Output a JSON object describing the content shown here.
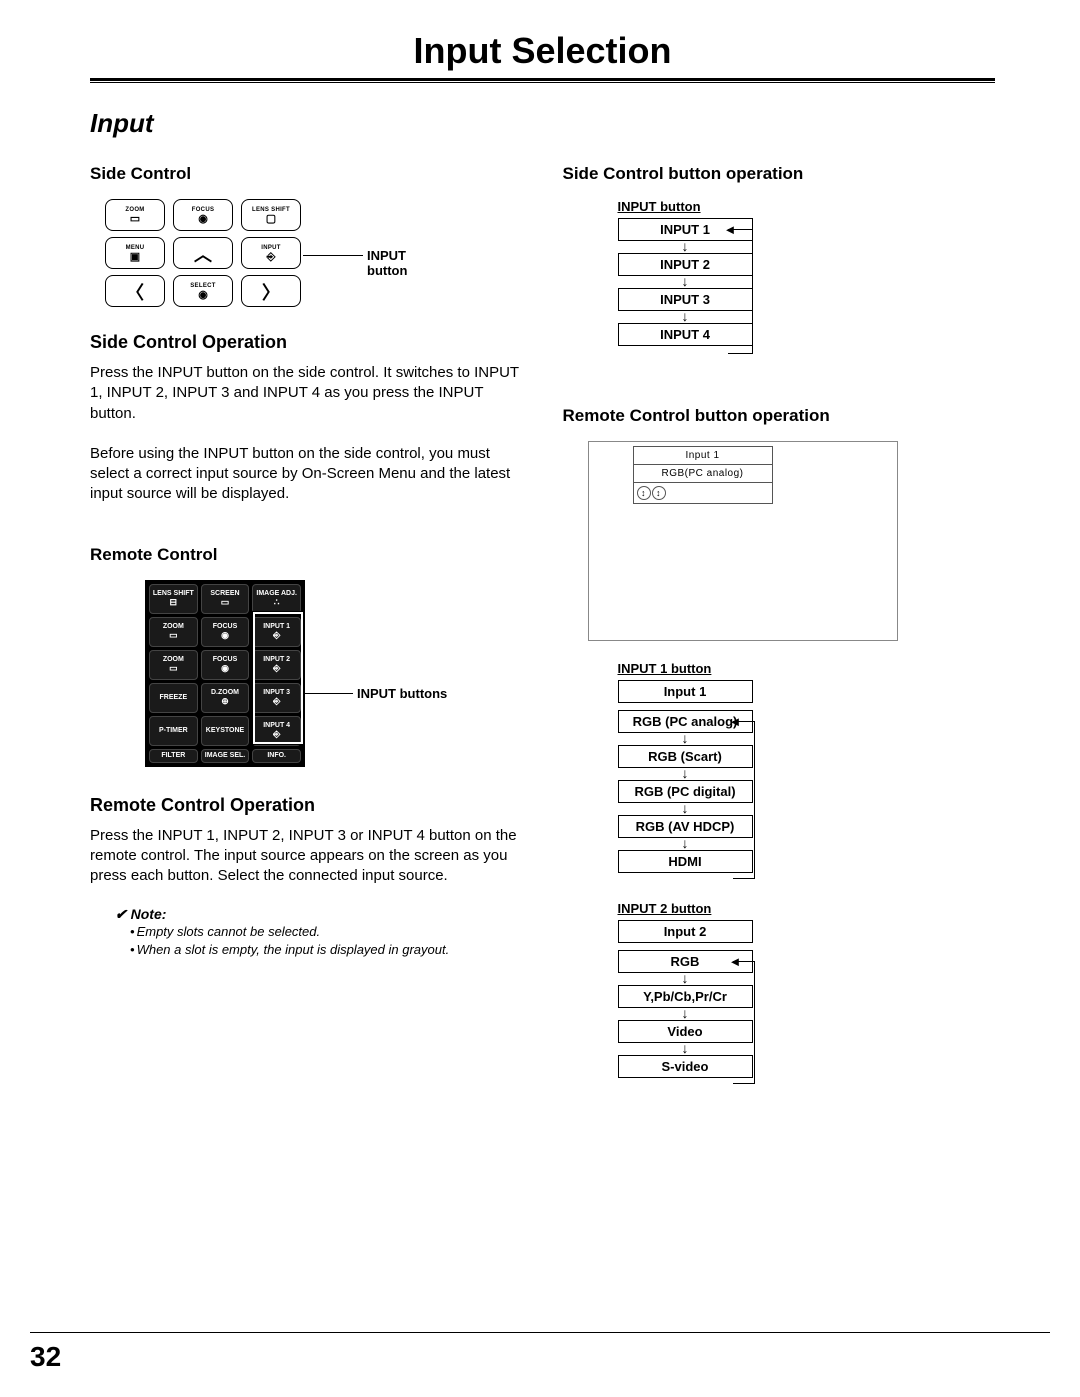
{
  "page_title": "Input Selection",
  "section_title": "Input",
  "page_number": "32",
  "left": {
    "side_control_h": "Side Control",
    "sc_buttons": {
      "zoom": "ZOOM",
      "focus": "FOCUS",
      "lens_shift": "LENS SHIFT",
      "menu": "MENU",
      "input": "INPUT",
      "select": "SELECT"
    },
    "input_button_label": "INPUT button",
    "side_op_h": "Side Control Operation",
    "side_op_p1": "Press the INPUT button on the side control. It switches to INPUT 1, INPUT 2, INPUT 3 and INPUT 4 as you press the INPUT button.",
    "side_op_p2": "Before using the INPUT button on the side control, you must select a correct input source by On-Screen Menu and the latest input source will be displayed.",
    "remote_h": "Remote Control",
    "remote_buttons": {
      "r0": "LENS SHIFT",
      "r1": "SCREEN",
      "r2": "IMAGE ADJ.",
      "r3": "ZOOM",
      "r4": "FOCUS",
      "r5": "INPUT 1",
      "r6": "ZOOM",
      "r7": "FOCUS",
      "r8": "INPUT 2",
      "r9": "FREEZE",
      "r10": "D.ZOOM",
      "r11": "INPUT 3",
      "r12": "P-TIMER",
      "r13": "KEYSTONE",
      "r14": "INPUT 4",
      "r15": "FILTER",
      "r16": "IMAGE SEL.",
      "r17": "INFO."
    },
    "input_buttons_label": "INPUT buttons",
    "remote_op_h": "Remote Control Operation",
    "remote_op_p": "Press the INPUT 1, INPUT 2, INPUT 3 or INPUT 4 button on the remote control. The input source appears on the screen as you press each button. Select the connected input source.",
    "note_h": "✔ Note:",
    "note_1": "Empty slots cannot be selected.",
    "note_2": "When a slot is empty, the input is displayed in grayout."
  },
  "right": {
    "sc_op_h": "Side Control button operation",
    "flow1_label": "INPUT button",
    "flow1": [
      "INPUT 1",
      "INPUT 2",
      "INPUT 3",
      "INPUT 4"
    ],
    "rc_op_h": "Remote Control button operation",
    "osd_line1": "Input 1",
    "osd_line2": "RGB(PC analog)",
    "flow2_label": "INPUT 1 button",
    "flow2_first": "Input 1",
    "flow2": [
      "RGB (PC analog)",
      "RGB (Scart)",
      "RGB (PC digital)",
      "RGB (AV HDCP)",
      "HDMI"
    ],
    "flow3_label": "INPUT 2 button",
    "flow3_first": "Input 2",
    "flow3": [
      "RGB",
      "Y,Pb/Cb,Pr/Cr",
      "Video",
      "S-video"
    ]
  }
}
